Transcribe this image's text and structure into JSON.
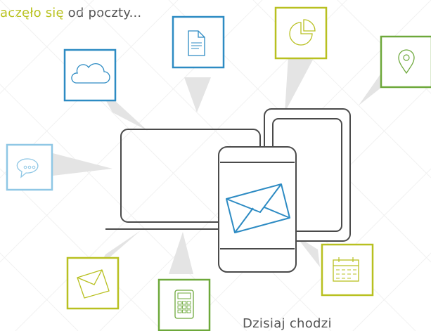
{
  "headline": {
    "accent_text": "aczęło się",
    "rest_text": " od poczty..."
  },
  "footer": {
    "text": "Dzisiaj chodzi"
  },
  "colors": {
    "blue": "#2d8bc3",
    "light_blue": "#8fc7e5",
    "olive": "#b8c020",
    "green": "#6da83a",
    "device": "#4a4a4a",
    "beam": "#e6e6e6",
    "grid": "#f1f1f1"
  },
  "icons": [
    {
      "name": "cloud-icon",
      "color": "blue"
    },
    {
      "name": "document-icon",
      "color": "blue"
    },
    {
      "name": "pie-chart-icon",
      "color": "olive"
    },
    {
      "name": "location-pin-icon",
      "color": "green"
    },
    {
      "name": "chat-bubble-icon",
      "color": "light_blue"
    },
    {
      "name": "envelope-icon",
      "color": "olive"
    },
    {
      "name": "calculator-icon",
      "color": "green"
    },
    {
      "name": "calendar-icon",
      "color": "olive"
    }
  ],
  "devices": [
    "laptop",
    "tablet",
    "smartphone"
  ],
  "central_icon": "mail-envelope-icon"
}
